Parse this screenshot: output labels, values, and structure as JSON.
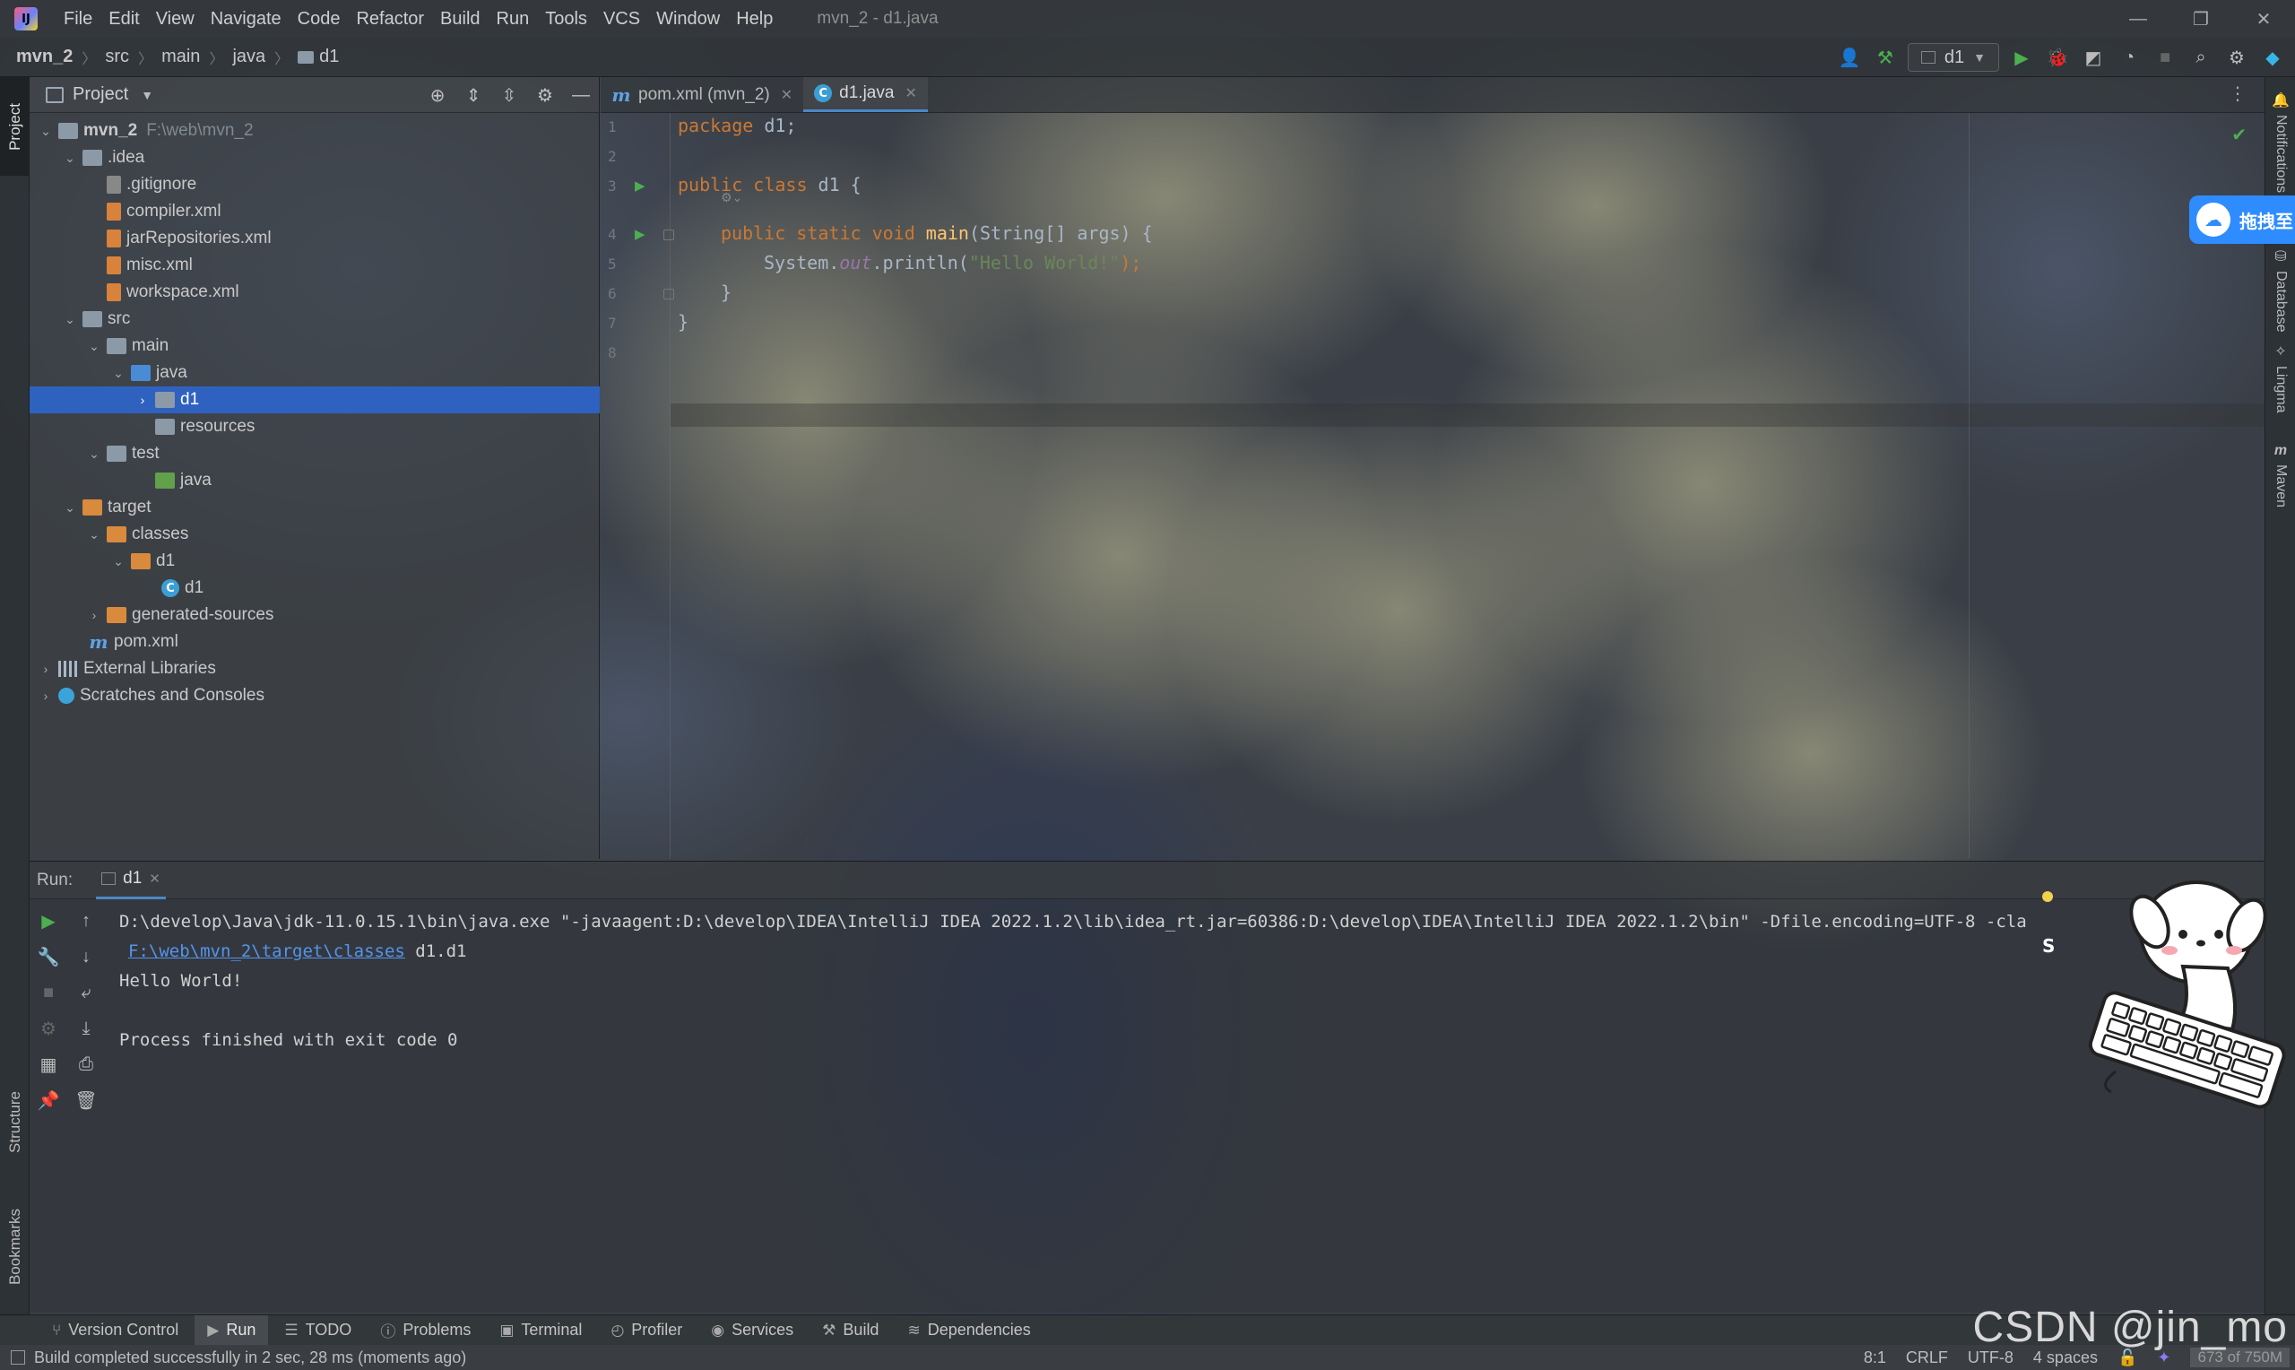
{
  "titlebar": {
    "menu": [
      "File",
      "Edit",
      "View",
      "Navigate",
      "Code",
      "Refactor",
      "Build",
      "Run",
      "Tools",
      "VCS",
      "Window",
      "Help"
    ],
    "window_title": "mvn_2 - d1.java",
    "minimize": "—",
    "restore": "❐",
    "close": "✕"
  },
  "navbar": {
    "breadcrumbs": [
      "mvn_2",
      "src",
      "main",
      "java",
      "d1"
    ],
    "run_config": "d1"
  },
  "left_strip": {
    "project_tab": "Project",
    "structure_tab": "Structure",
    "bookmarks_tab": "Bookmarks"
  },
  "project_panel": {
    "title": "Project",
    "tree": [
      {
        "label": "mvn_2",
        "path": "F:\\web\\mvn_2"
      },
      {
        "label": ".idea"
      },
      {
        "label": ".gitignore"
      },
      {
        "label": "compiler.xml"
      },
      {
        "label": "jarRepositories.xml"
      },
      {
        "label": "misc.xml"
      },
      {
        "label": "workspace.xml"
      },
      {
        "label": "src"
      },
      {
        "label": "main"
      },
      {
        "label": "java"
      },
      {
        "label": "d1"
      },
      {
        "label": "resources"
      },
      {
        "label": "test"
      },
      {
        "label": "java"
      },
      {
        "label": "target"
      },
      {
        "label": "classes"
      },
      {
        "label": "d1"
      },
      {
        "label": "d1"
      },
      {
        "label": "generated-sources"
      },
      {
        "label": "pom.xml"
      },
      {
        "label": "External Libraries"
      },
      {
        "label": "Scratches and Consoles"
      }
    ]
  },
  "editor": {
    "tabs": [
      {
        "label": "pom.xml (mvn_2)",
        "icon_letter": "m"
      },
      {
        "label": "d1.java",
        "icon_letter": "C"
      }
    ],
    "line_numbers": [
      "1",
      "2",
      "3",
      "4",
      "5",
      "6",
      "7",
      "8"
    ],
    "code": {
      "l1_kw": "package",
      "l1_rest": " d1;",
      "l3_kw": "public class",
      "l3_rest": " d1 {",
      "l4_kw": "public static void",
      "l4_fn": "main",
      "l4_rest": "(String[] args) {",
      "l5_a": "System.",
      "l5_fld": "out",
      "l5_b": ".println(",
      "l5_str": "\"Hello World!\"",
      "l5_c": ");",
      "l6": "}",
      "l7": "}"
    }
  },
  "right_strip": {
    "items": [
      "Notifications",
      "Database",
      "Lingma",
      "Maven"
    ]
  },
  "baidu_badge": "拖拽至",
  "run_panel": {
    "label": "Run:",
    "tab": "d1",
    "console": {
      "line1": "D:\\develop\\Java\\jdk-11.0.15.1\\bin\\java.exe \"-javaagent:D:\\develop\\IDEA\\IntelliJ IDEA 2022.1.2\\lib\\idea_rt.jar=60386:D:\\develop\\IDEA\\IntelliJ IDEA 2022.1.2\\bin\" -Dfile.encoding=UTF-8 -cla",
      "line2_link": "F:\\web\\mvn_2\\target\\classes",
      "line2_rest": " d1.d1",
      "line3": "Hello World!",
      "line5": "Process finished with exit code 0"
    }
  },
  "bottom_tools": [
    {
      "label": "Version Control",
      "icon": "branch-icon"
    },
    {
      "label": "Run",
      "icon": "play-icon"
    },
    {
      "label": "TODO",
      "icon": "list-icon"
    },
    {
      "label": "Problems",
      "icon": "problems-icon"
    },
    {
      "label": "Terminal",
      "icon": "terminal-icon"
    },
    {
      "label": "Profiler",
      "icon": "profiler-icon"
    },
    {
      "label": "Services",
      "icon": "services-icon"
    },
    {
      "label": "Build",
      "icon": "hammer-icon"
    },
    {
      "label": "Dependencies",
      "icon": "layers-icon"
    }
  ],
  "watermark": "CSDN @jin_mo",
  "status_bar": {
    "message": "Build completed successfully in 2 sec, 28 ms (moments ago)",
    "position": "8:1",
    "line_sep": "CRLF",
    "encoding": "UTF-8",
    "indent": "4 spaces",
    "memory": "673 of 750M"
  },
  "colors": {
    "selection": "#2e65ca",
    "keyword": "#cc7832",
    "string": "#6a8759",
    "field": "#9876aa",
    "function": "#ffc66d",
    "link": "#5394ec"
  }
}
